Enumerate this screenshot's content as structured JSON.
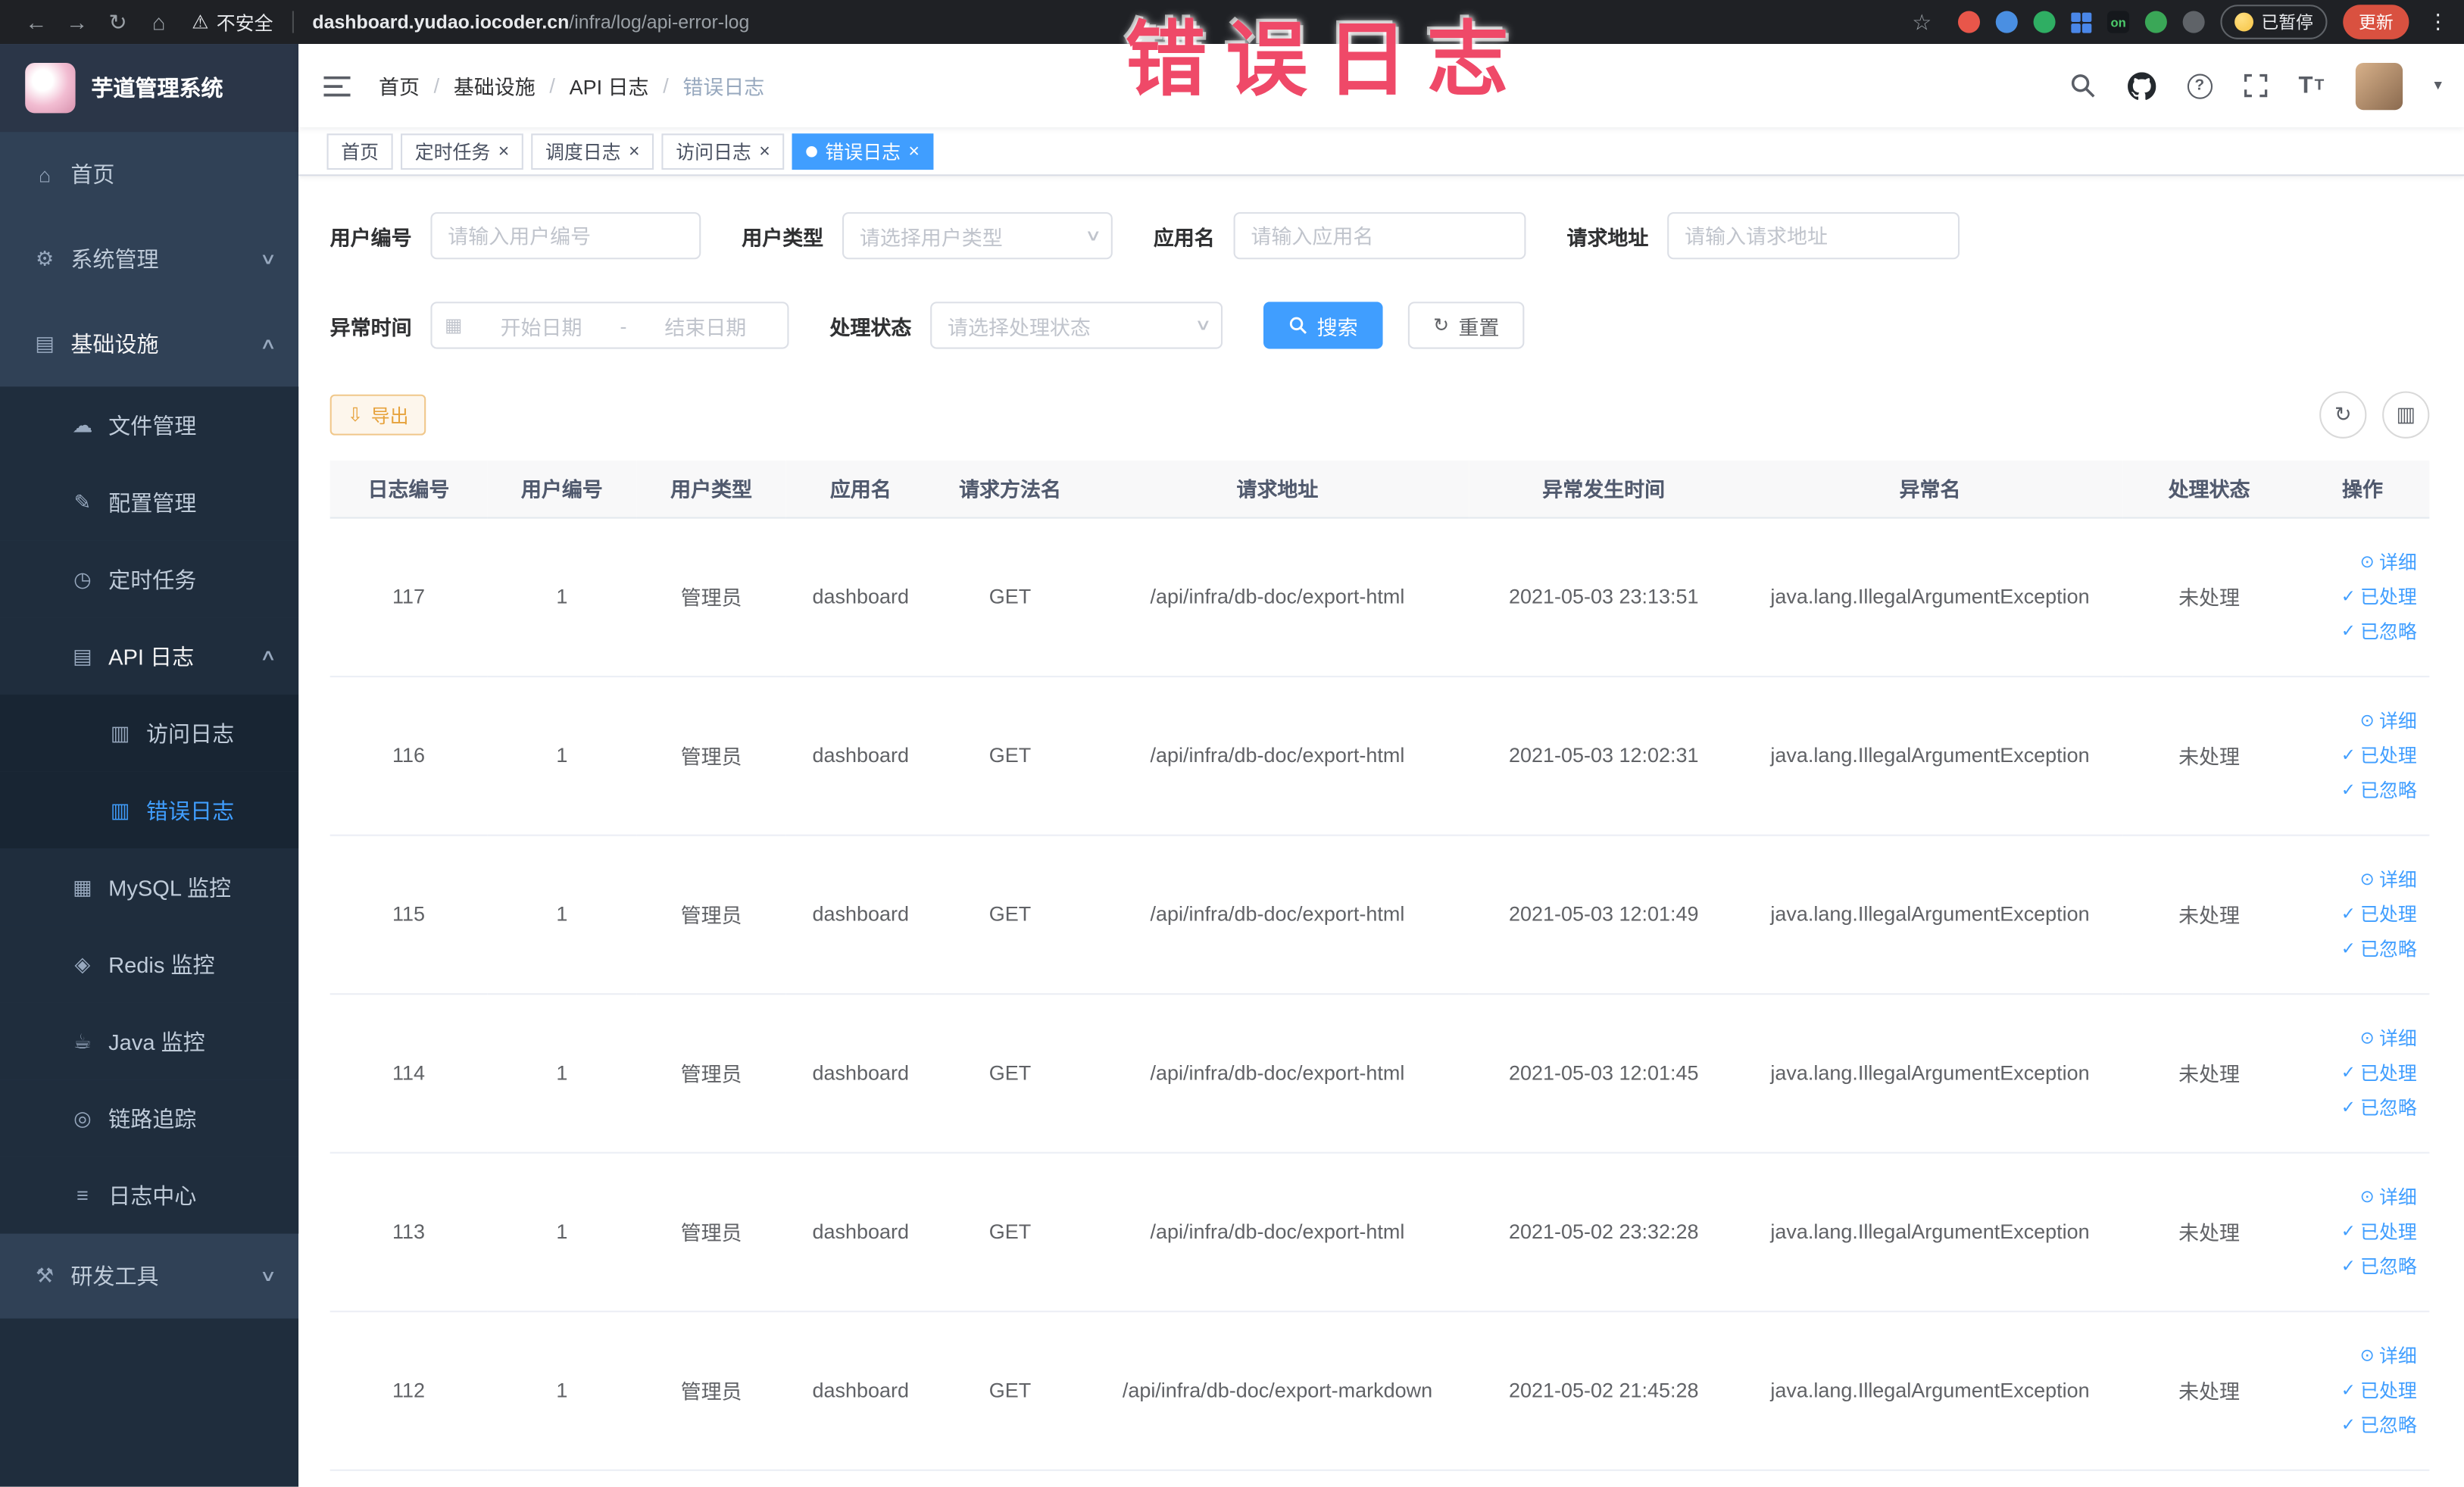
{
  "browser": {
    "security_label": "不安全",
    "url_domain": "dashboard.yudao.iocoder.cn",
    "url_path": "/infra/log/api-error-log",
    "paused_label": "已暂停",
    "update_label": "更新"
  },
  "annotation": "错误日志",
  "sidebar": {
    "logo_title": "芋道管理系统",
    "items": {
      "home": "首页",
      "system": "系统管理",
      "infra": "基础设施",
      "file": "文件管理",
      "config": "配置管理",
      "job": "定时任务",
      "api_log": "API 日志",
      "access_log": "访问日志",
      "error_log": "错误日志",
      "mysql": "MySQL 监控",
      "redis": "Redis 监控",
      "java": "Java 监控",
      "trace": "链路追踪",
      "log_center": "日志中心",
      "dev_tools": "研发工具"
    }
  },
  "header": {
    "breadcrumb": [
      "首页",
      "基础设施",
      "API 日志",
      "错误日志"
    ]
  },
  "tabs": [
    {
      "label": "首页",
      "closable": false,
      "active": false
    },
    {
      "label": "定时任务",
      "closable": true,
      "active": false
    },
    {
      "label": "调度日志",
      "closable": true,
      "active": false
    },
    {
      "label": "访问日志",
      "closable": true,
      "active": false
    },
    {
      "label": "错误日志",
      "closable": true,
      "active": true
    }
  ],
  "filters": {
    "user_id": {
      "label": "用户编号",
      "placeholder": "请输入用户编号",
      "value": ""
    },
    "user_type": {
      "label": "用户类型",
      "placeholder": "请选择用户类型"
    },
    "app_name": {
      "label": "应用名",
      "placeholder": "请输入应用名",
      "value": ""
    },
    "request_url": {
      "label": "请求地址",
      "placeholder": "请输入请求地址",
      "value": ""
    },
    "exception_time": {
      "label": "异常时间",
      "start_placeholder": "开始日期",
      "separator": "-",
      "end_placeholder": "结束日期"
    },
    "process_status": {
      "label": "处理状态",
      "placeholder": "请选择处理状态"
    },
    "search_label": "搜索",
    "reset_label": "重置"
  },
  "toolbar": {
    "export_label": "导出"
  },
  "table": {
    "columns": [
      "日志编号",
      "用户编号",
      "用户类型",
      "应用名",
      "请求方法名",
      "请求地址",
      "异常发生时间",
      "异常名",
      "处理状态",
      "操作"
    ],
    "ops": {
      "detail": "详细",
      "processed": "已处理",
      "ignored": "已忽略"
    },
    "rows": [
      {
        "id": "117",
        "user_id": "1",
        "user_type": "管理员",
        "app_name": "dashboard",
        "method": "GET",
        "url": "/api/infra/db-doc/export-html",
        "time": "2021-05-03 23:13:51",
        "exception": "java.lang.IllegalArgumentException",
        "status": "未处理"
      },
      {
        "id": "116",
        "user_id": "1",
        "user_type": "管理员",
        "app_name": "dashboard",
        "method": "GET",
        "url": "/api/infra/db-doc/export-html",
        "time": "2021-05-03 12:02:31",
        "exception": "java.lang.IllegalArgumentException",
        "status": "未处理"
      },
      {
        "id": "115",
        "user_id": "1",
        "user_type": "管理员",
        "app_name": "dashboard",
        "method": "GET",
        "url": "/api/infra/db-doc/export-html",
        "time": "2021-05-03 12:01:49",
        "exception": "java.lang.IllegalArgumentException",
        "status": "未处理"
      },
      {
        "id": "114",
        "user_id": "1",
        "user_type": "管理员",
        "app_name": "dashboard",
        "method": "GET",
        "url": "/api/infra/db-doc/export-html",
        "time": "2021-05-03 12:01:45",
        "exception": "java.lang.IllegalArgumentException",
        "status": "未处理"
      },
      {
        "id": "113",
        "user_id": "1",
        "user_type": "管理员",
        "app_name": "dashboard",
        "method": "GET",
        "url": "/api/infra/db-doc/export-html",
        "time": "2021-05-02 23:32:28",
        "exception": "java.lang.IllegalArgumentException",
        "status": "未处理"
      },
      {
        "id": "112",
        "user_id": "1",
        "user_type": "管理员",
        "app_name": "dashboard",
        "method": "GET",
        "url": "/api/infra/db-doc/export-markdown",
        "time": "2021-05-02 21:45:28",
        "exception": "java.lang.IllegalArgumentException",
        "status": "未处理"
      }
    ]
  },
  "icons": {
    "back": "←",
    "forward": "→",
    "reload": "↻",
    "home": "⌂",
    "warning": "⚠",
    "star": "☆",
    "kebab": "⋮",
    "close": "×",
    "breadcrumb_sep": "/",
    "chevron_down": "∨",
    "chevron_up": "∧",
    "caret_down": "▾",
    "menu_home": "⌂",
    "menu_system": "⚙",
    "menu_infra": "▤",
    "menu_file": "☁",
    "menu_config": "✎",
    "menu_job": "◷",
    "menu_api_log": "▤",
    "menu_access_log": "▥",
    "menu_error_log": "▥",
    "menu_mysql": "▦",
    "menu_redis": "◈",
    "menu_java": "☕",
    "menu_trace": "◎",
    "menu_log_center": "≡",
    "menu_dev_tools": "⚒",
    "calendar": "▦",
    "reset": "↻",
    "export": "⇩",
    "refresh": "↻",
    "columns": "▥",
    "eye": "⊙",
    "check": "✓",
    "help": "?",
    "font_size": "T",
    "on_badge": "on"
  },
  "colors": {
    "accent": "#409eff",
    "warning": "#e6a23c",
    "annotation_red": "#ef4968",
    "sidebar_bg": "#304156"
  }
}
